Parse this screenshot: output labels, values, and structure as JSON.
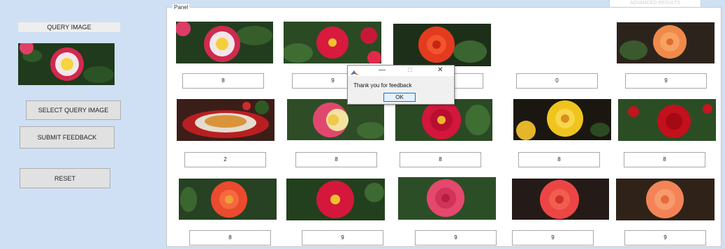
{
  "left": {
    "query_label": "QUERY IMAGE",
    "select_button": "SELECT QUERY IMAGE",
    "submit_button": "SUBMIT FEEDBACK",
    "reset_button": "RESET"
  },
  "panel": {
    "title": "Panel",
    "tab_label": "ADVANCED RESULTS"
  },
  "results": [
    {
      "score": "8",
      "image": "rose-white-pink-image"
    },
    {
      "score": "9",
      "image": "rose-red-image"
    },
    {
      "score": "",
      "image": "rose-orange-red-image"
    },
    {
      "score": "0",
      "image": ""
    },
    {
      "score": "9",
      "image": "rose-peach-image"
    },
    {
      "score": "2",
      "image": "food-plate-image"
    },
    {
      "score": "8",
      "image": "rose-pink-yellow-image"
    },
    {
      "score": "8",
      "image": "rose-crimson-image"
    },
    {
      "score": "8",
      "image": "rose-yellow-image"
    },
    {
      "score": "8",
      "image": "rose-dark-red-image"
    },
    {
      "score": "8",
      "image": "rose-coral-image"
    },
    {
      "score": "9",
      "image": "rose-red-open-image"
    },
    {
      "score": "9",
      "image": "rose-pink-image"
    },
    {
      "score": "9",
      "image": "rose-scarlet-image"
    },
    {
      "score": "9",
      "image": "rose-salmon-image"
    }
  ],
  "dialog": {
    "message": "Thank you for feedback",
    "ok_label": "OK",
    "minimize_glyph": "—",
    "maximize_glyph": "□",
    "close_glyph": "✕"
  },
  "colors": {
    "background_panel": "#cfe0f4",
    "button": "#e1e1e1",
    "dialog_accent": "#0078d7"
  }
}
